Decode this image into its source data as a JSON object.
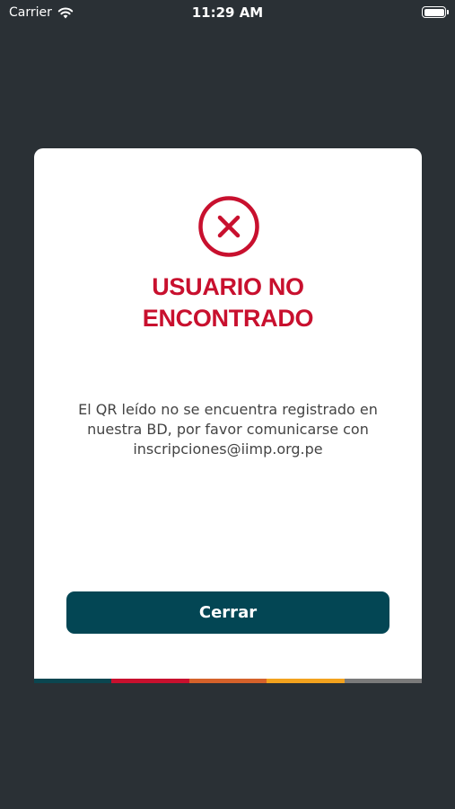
{
  "status_bar": {
    "carrier": "Carrier",
    "time": "11:29 AM",
    "icons": [
      "wifi-icon",
      "battery-icon"
    ]
  },
  "dialog": {
    "icon": "error-x-circle-icon",
    "title_line1": "USUARIO NO",
    "title_line2": "ENCONTRADO",
    "message_line1": "El QR leído no se encuentra registrado en",
    "message_line2": "nuestra BD, por favor comunicarse con",
    "message_line3": "inscripciones@iimp.org.pe",
    "close_label": "Cerrar"
  },
  "colors": {
    "background": "#2a3035",
    "error_red": "#c8102e",
    "button": "#034654",
    "strip": [
      "#0b4650",
      "#c8102e",
      "#d5612a",
      "#f2a21e",
      "#7a7a7a"
    ]
  }
}
